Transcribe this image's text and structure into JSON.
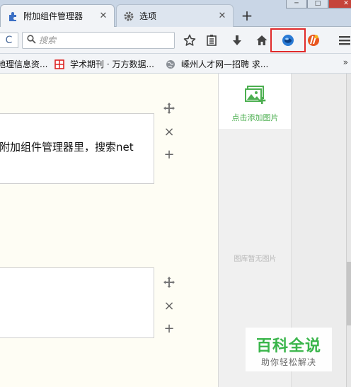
{
  "tabs": [
    {
      "label": "附加组件管理器",
      "icon": "puzzle-icon",
      "active": true
    },
    {
      "label": "选项",
      "icon": "gear-icon",
      "active": false
    }
  ],
  "window": {
    "minimize": "─",
    "maximize": "□"
  },
  "toolbar": {
    "reload": "C",
    "search_placeholder": "搜索",
    "icons": [
      "star-icon",
      "reading-list-icon",
      "download-icon",
      "home-icon",
      "extension-blue-icon",
      "extension-orange-icon",
      "menu-icon"
    ]
  },
  "bookmarks": [
    {
      "label": "地理信息资...",
      "icon": "bookmark-icon"
    },
    {
      "label": "学术期刊 · 万方数据...",
      "icon": "wanfang-icon"
    },
    {
      "label": "嵊州人才网—招聘 求...",
      "icon": "globe-icon"
    }
  ],
  "bookmarks_more": "»",
  "content": {
    "box1_text": "附加组件管理器里，搜索net",
    "box2_text": "",
    "controls": {
      "move": "move-icon",
      "remove": "×",
      "add": "+"
    }
  },
  "sidepanel": {
    "add_label": "点击添加图片",
    "empty_label": "图库暂无图片"
  },
  "watermark": {
    "title": "百科全说",
    "subtitle": "助你轻松解决"
  },
  "colors": {
    "accent_green": "#39b54a",
    "highlight_red": "#e02a2a",
    "content_bg": "#fefdf4"
  }
}
